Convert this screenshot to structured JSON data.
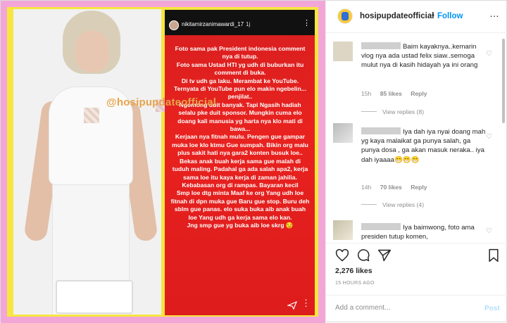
{
  "media": {
    "watermark": "@hosipupdateofficial",
    "story": {
      "username": "nikitamirzanimawardi_17",
      "time": "1j",
      "text": "Foto sama  pak President indonesia comment nya di tutup.\nFoto sama Ustad HTI yg udh di buburkan itu comment di buka.\nDi tv udh ga laku. Merambat ke YouTube.\nTernyata di YouTube pun elo makin ngebelin...\npenjilat..\nNgomong duit banyak. Tapi Ngasih hadiah selalu pke duit sponsor. Mungkin cuma elo doang kali manusia yg harta nya klo mati di bawa...\nKerjaan nya fitnah mulu. Pengen gue gampar muka loe klo ktmu Gue sumpah. Bikin org malu plus sakit hati nya gara2 konten busuk loe..\nBekas anak buah kerja sama gue malah di tuduh maling. Padahal ga ada salah apa2, kerja sama loe itu kaya kerja di zaman jahilia. Kebabasan org di rampas. Bayaran kecil\nSmp loe dtg minta Maaf ke org Yang udh loe fitnah di dpn muka gue Baru gue stop. Buru deh sblm gue panas. elo suka buka aib anak buah loe Yang udh ga kerja sama elo kan.\nJng smp gue yg buka aib loe skrg 😏"
    }
  },
  "header": {
    "username": "hosipupdateofficial",
    "separator": "•",
    "follow_label": "Follow",
    "more_icon": "…"
  },
  "comments": [
    {
      "text": "Baim kayaknya..kemarin vlog nya ada ustad felix siaw..semoga mulut nya di kasih hidayah ya ini orang",
      "time": "15h",
      "likes": "85 likes",
      "reply": "Reply",
      "view_replies": "View replies (8)"
    },
    {
      "text": "Iya dah iya nyai doang mah yg kaya malaikat ga punya salah, ga punya dosa , ga akan masuk neraka.. iya dah iyaaaa😁😁😁",
      "time": "14h",
      "likes": "70 likes",
      "reply": "Reply",
      "view_replies": "View replies (4)"
    },
    {
      "text": "Iya baimwong, foto ama presiden tutup komen,"
    }
  ],
  "post": {
    "likes": "2,276 likes",
    "time_ago": "15 HOURS AGO"
  },
  "add_comment": {
    "placeholder": "Add a comment...",
    "post_label": "Post"
  }
}
